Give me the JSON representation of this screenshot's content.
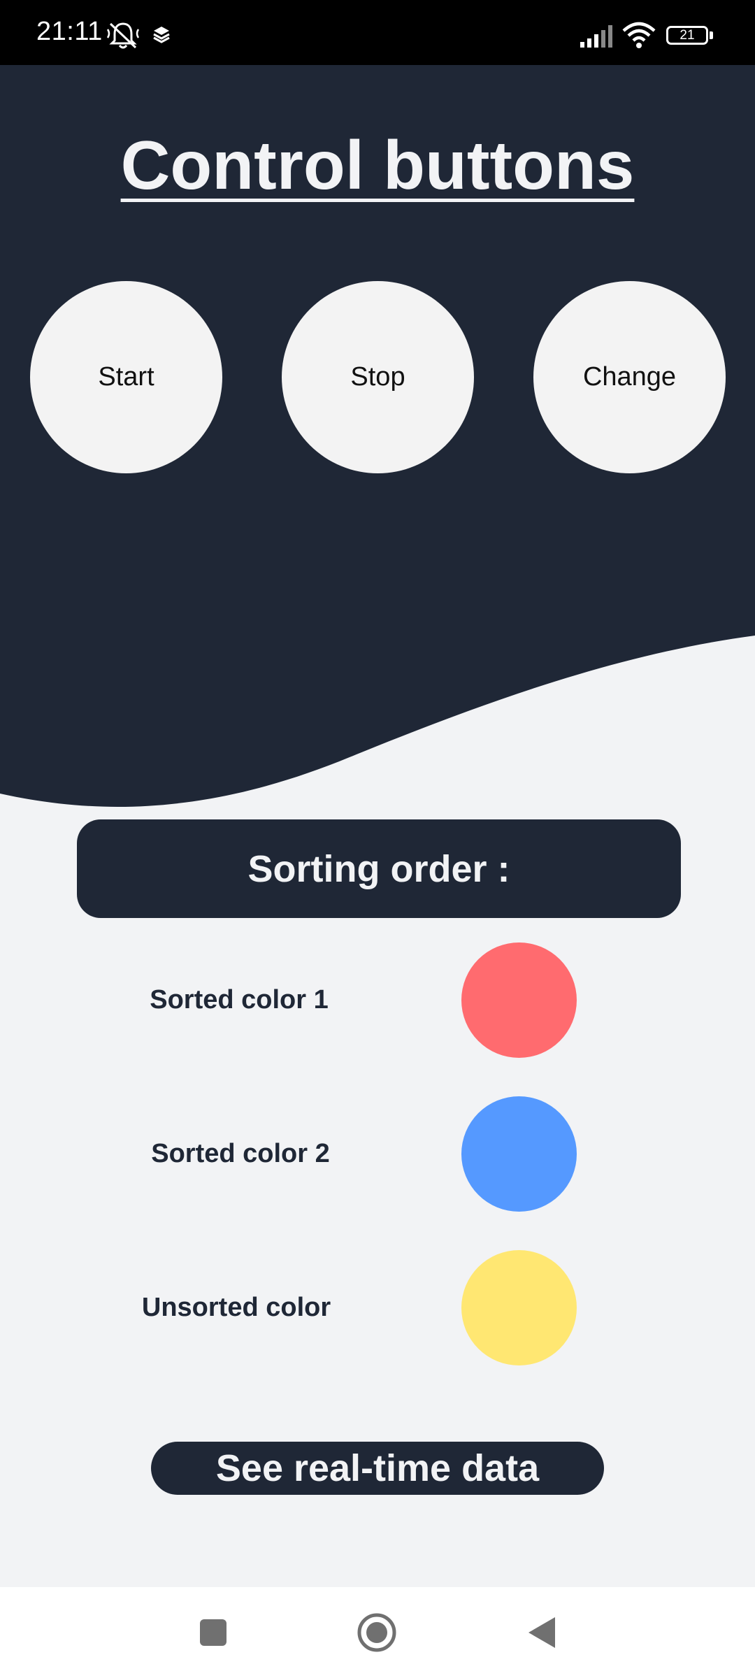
{
  "status_bar": {
    "time": "21:11",
    "battery": "21",
    "icons": [
      "mute-notifications-icon",
      "layers-icon",
      "signal-icon",
      "wifi-icon",
      "battery-icon"
    ]
  },
  "header": {
    "title": "Control buttons",
    "background_color": "#1f2736"
  },
  "controls": [
    {
      "label": "Start"
    },
    {
      "label": "Stop"
    },
    {
      "label": "Change"
    }
  ],
  "sorting": {
    "title": "Sorting order :",
    "items": [
      {
        "label": "Sorted color 1",
        "color": "#ff6b6f"
      },
      {
        "label": "Sorted color 2",
        "color": "#5599ff"
      },
      {
        "label": "Unsorted color",
        "color": "#ffe772"
      }
    ]
  },
  "realtime_button": {
    "label": "See real-time data"
  },
  "nav_bar": {
    "icons": [
      "recent-apps-icon",
      "home-icon",
      "back-icon"
    ]
  }
}
